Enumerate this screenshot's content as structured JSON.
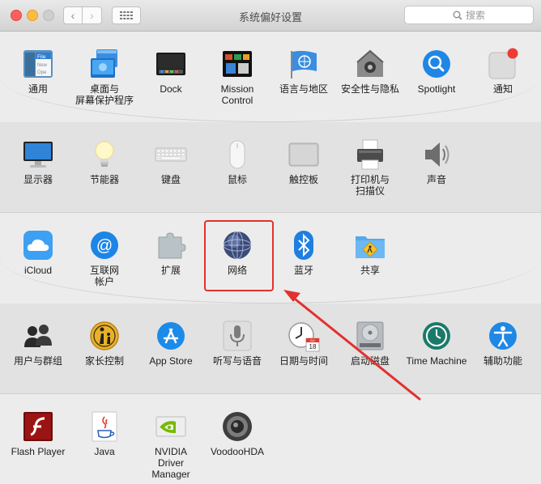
{
  "window": {
    "title": "系统偏好设置"
  },
  "search": {
    "placeholder": "搜索"
  },
  "sections": [
    {
      "panes": [
        {
          "label": "通用",
          "icon": "general-icon",
          "icon_text": [
            "File",
            "New",
            "Ope"
          ]
        },
        {
          "label": "桌面与\n屏幕保护程序",
          "icon": "desktop-screensaver-icon"
        },
        {
          "label": "Dock",
          "icon": "dock-icon"
        },
        {
          "label": "Mission\nControl",
          "icon": "mission-control-icon"
        },
        {
          "label": "语言与地区",
          "icon": "language-region-icon"
        },
        {
          "label": "安全性与隐私",
          "icon": "security-privacy-icon"
        },
        {
          "label": "Spotlight",
          "icon": "spotlight-icon"
        },
        {
          "label": "通知",
          "icon": "notifications-icon"
        }
      ]
    },
    {
      "panes": [
        {
          "label": "显示器",
          "icon": "displays-icon"
        },
        {
          "label": "节能器",
          "icon": "energy-saver-icon"
        },
        {
          "label": "键盘",
          "icon": "keyboard-icon"
        },
        {
          "label": "鼠标",
          "icon": "mouse-icon"
        },
        {
          "label": "触控板",
          "icon": "trackpad-icon"
        },
        {
          "label": "打印机与\n扫描仪",
          "icon": "printers-scanners-icon"
        },
        {
          "label": "声音",
          "icon": "sound-icon"
        }
      ]
    },
    {
      "panes": [
        {
          "label": "iCloud",
          "icon": "icloud-icon"
        },
        {
          "label": "互联网\n帐户",
          "icon": "internet-accounts-icon"
        },
        {
          "label": "扩展",
          "icon": "extensions-icon"
        },
        {
          "label": "网络",
          "icon": "network-icon"
        },
        {
          "label": "蓝牙",
          "icon": "bluetooth-icon"
        },
        {
          "label": "共享",
          "icon": "sharing-icon"
        }
      ]
    },
    {
      "panes": [
        {
          "label": "用户与群组",
          "icon": "users-groups-icon"
        },
        {
          "label": "家长控制",
          "icon": "parental-controls-icon"
        },
        {
          "label": "App Store",
          "icon": "app-store-icon"
        },
        {
          "label": "听写与语音",
          "icon": "dictation-speech-icon"
        },
        {
          "label": "日期与时间",
          "icon": "date-time-icon",
          "icon_text": [
            "JUL",
            "18"
          ]
        },
        {
          "label": "启动磁盘",
          "icon": "startup-disk-icon"
        },
        {
          "label": "Time Machine",
          "icon": "time-machine-icon"
        },
        {
          "label": "辅助功能",
          "icon": "accessibility-icon"
        }
      ]
    },
    {
      "panes": [
        {
          "label": "Flash Player",
          "icon": "flash-player-icon"
        },
        {
          "label": "Java",
          "icon": "java-icon"
        },
        {
          "label": "NVIDIA\nDriver Manager",
          "icon": "nvidia-driver-manager-icon"
        },
        {
          "label": "VoodooHDA",
          "icon": "voodoohda-icon"
        }
      ]
    }
  ],
  "annotation": {
    "color": "#e2312e",
    "target": "network-icon"
  }
}
